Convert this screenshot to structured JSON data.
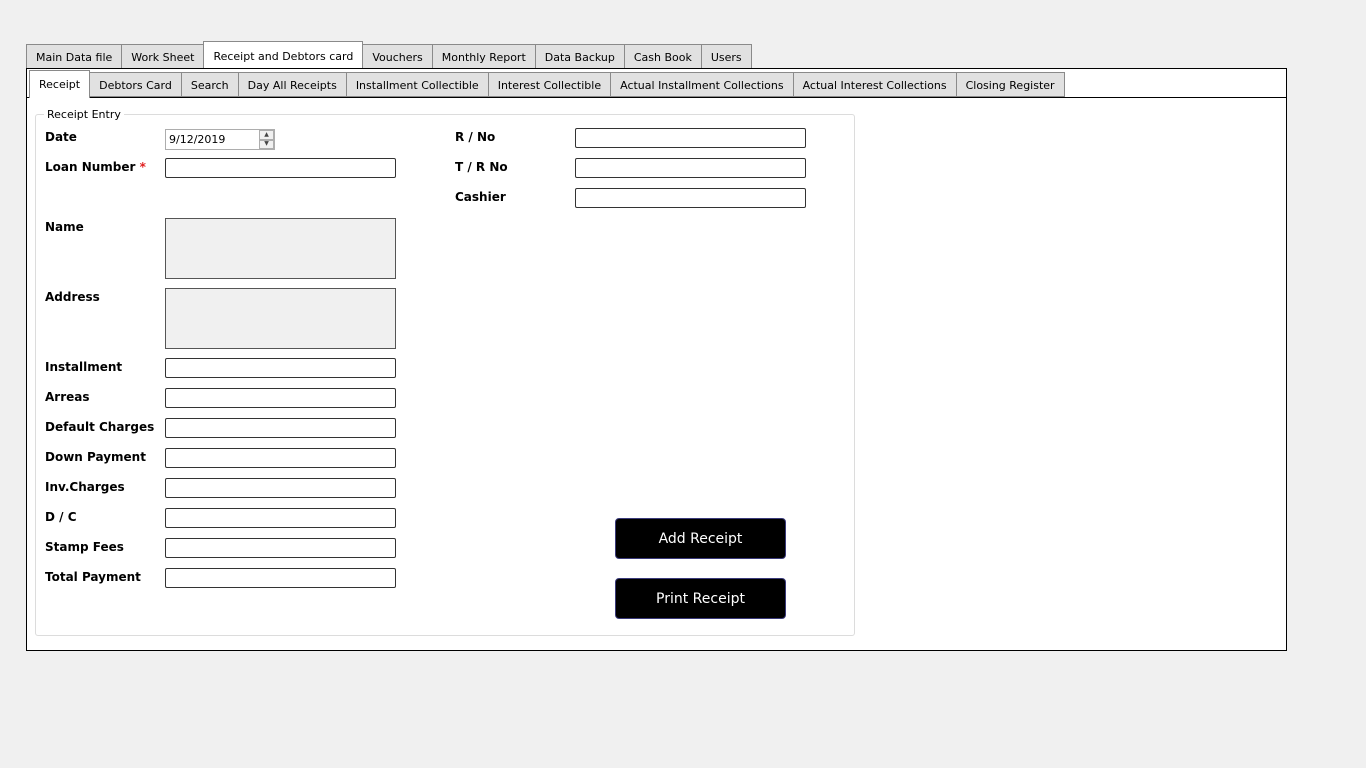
{
  "main_tabs": [
    {
      "label": "Main Data file"
    },
    {
      "label": "Work Sheet"
    },
    {
      "label": "Receipt and Debtors card"
    },
    {
      "label": "Vouchers"
    },
    {
      "label": "Monthly Report"
    },
    {
      "label": "Data Backup"
    },
    {
      "label": "Cash Book"
    },
    {
      "label": "Users"
    }
  ],
  "sub_tabs": [
    {
      "label": "Receipt"
    },
    {
      "label": "Debtors Card"
    },
    {
      "label": "Search"
    },
    {
      "label": "Day All Receipts"
    },
    {
      "label": "Installment Collectible"
    },
    {
      "label": "Interest Collectible"
    },
    {
      "label": "Actual Installment Collections"
    },
    {
      "label": "Actual Interest Collections"
    },
    {
      "label": "Closing Register"
    }
  ],
  "receipt_entry": {
    "legend": "Receipt Entry",
    "date_label": "Date",
    "date_value": "9/12/2019",
    "loan_number_label": "Loan Number",
    "required_mark": "*",
    "name_label": "Name",
    "address_label": "Address",
    "installment_label": "Installment",
    "arreas_label": "Arreas",
    "default_charges_label": "Default Charges",
    "down_payment_label": "Down Payment",
    "inv_charges_label": "Inv.Charges",
    "dc_label": "D / C",
    "stamp_fees_label": "Stamp Fees",
    "total_payment_label": "Total Payment",
    "rno_label": "R / No",
    "trno_label": "T / R No",
    "cashier_label": "Cashier",
    "add_receipt_label": "Add Receipt",
    "print_receipt_label": "Print Receipt"
  }
}
